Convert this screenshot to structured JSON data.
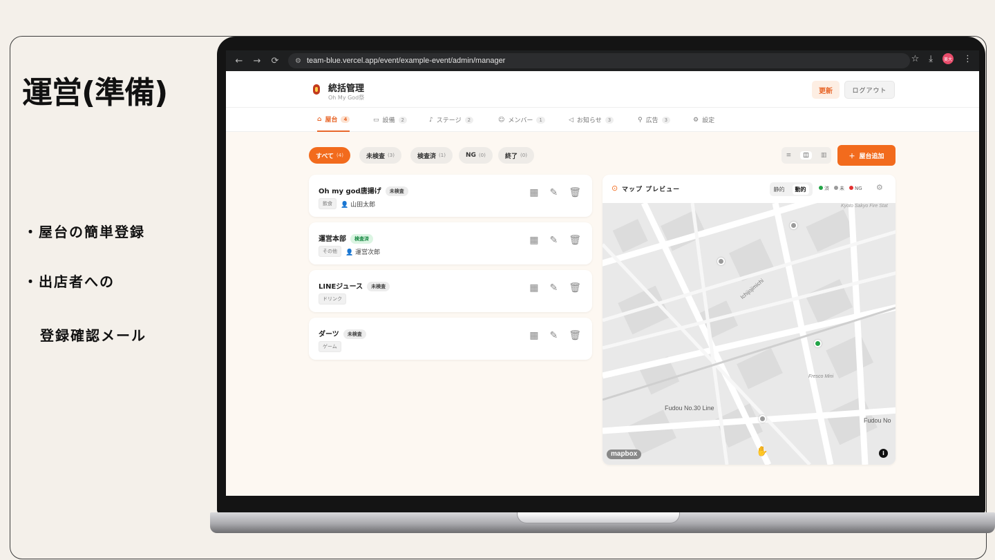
{
  "slide": {
    "title": "運営(準備)",
    "bullets": [
      "・屋台の簡単登録",
      "・出店者への",
      "登録確認メール"
    ]
  },
  "browser": {
    "url": "team-blue.vercel.app/event/example-event/admin/manager",
    "profile_initials": "美大"
  },
  "header": {
    "title": "統括管理",
    "subtitle": "Oh My God祭",
    "update_label": "更新",
    "logout_label": "ログアウト"
  },
  "tabs": [
    {
      "label": "屋台",
      "count": "4",
      "icon": "store-icon",
      "active": true
    },
    {
      "label": "設備",
      "count": "2",
      "icon": "box-icon",
      "active": false
    },
    {
      "label": "ステージ",
      "count": "2",
      "icon": "mic-icon",
      "active": false
    },
    {
      "label": "メンバー",
      "count": "1",
      "icon": "users-icon",
      "active": false
    },
    {
      "label": "お知らせ",
      "count": "3",
      "icon": "megaphone-icon",
      "active": false
    },
    {
      "label": "広告",
      "count": "3",
      "icon": "signpost-icon",
      "active": false
    },
    {
      "label": "設定",
      "count": "",
      "icon": "gear-icon",
      "active": false
    }
  ],
  "filters": [
    {
      "label": "すべて",
      "count": "(4)",
      "active": true
    },
    {
      "label": "未検査",
      "count": "(3)",
      "active": false
    },
    {
      "label": "検査済",
      "count": "(1)",
      "active": false
    },
    {
      "label": "NG",
      "count": "(0)",
      "active": false
    },
    {
      "label": "終了",
      "count": "(0)",
      "active": false
    }
  ],
  "add_button": {
    "label": "屋台追加",
    "icon": "plus"
  },
  "stalls": [
    {
      "name": "Oh my god唐揚げ",
      "status": "未検査",
      "category": "飲食",
      "person": "山田太郎"
    },
    {
      "name": "運営本部",
      "status": "検査済",
      "category": "その他",
      "person": "運営次郎"
    },
    {
      "name": "LINEジュース",
      "status": "未検査",
      "category": "ドリンク",
      "person": ""
    },
    {
      "name": "ダーツ",
      "status": "未検査",
      "category": "ゲーム",
      "person": ""
    }
  ],
  "map": {
    "title": "マップ プレビュー",
    "mode_static": "静的",
    "mode_dynamic": "動的",
    "legend": [
      {
        "label": "済",
        "color": "#22a447"
      },
      {
        "label": "未",
        "color": "#9a9a9a"
      },
      {
        "label": "NG",
        "color": "#e23030"
      }
    ],
    "street_labels": [
      "Kyoto Sakyo Fire Stat",
      "Ichijojimichi",
      "Fresco Mini",
      "Fudou No.30 Line",
      "Fudou No"
    ],
    "attribution": "mapbox"
  },
  "colors": {
    "accent": "#f26b1d",
    "status_ok": "#22a447"
  }
}
